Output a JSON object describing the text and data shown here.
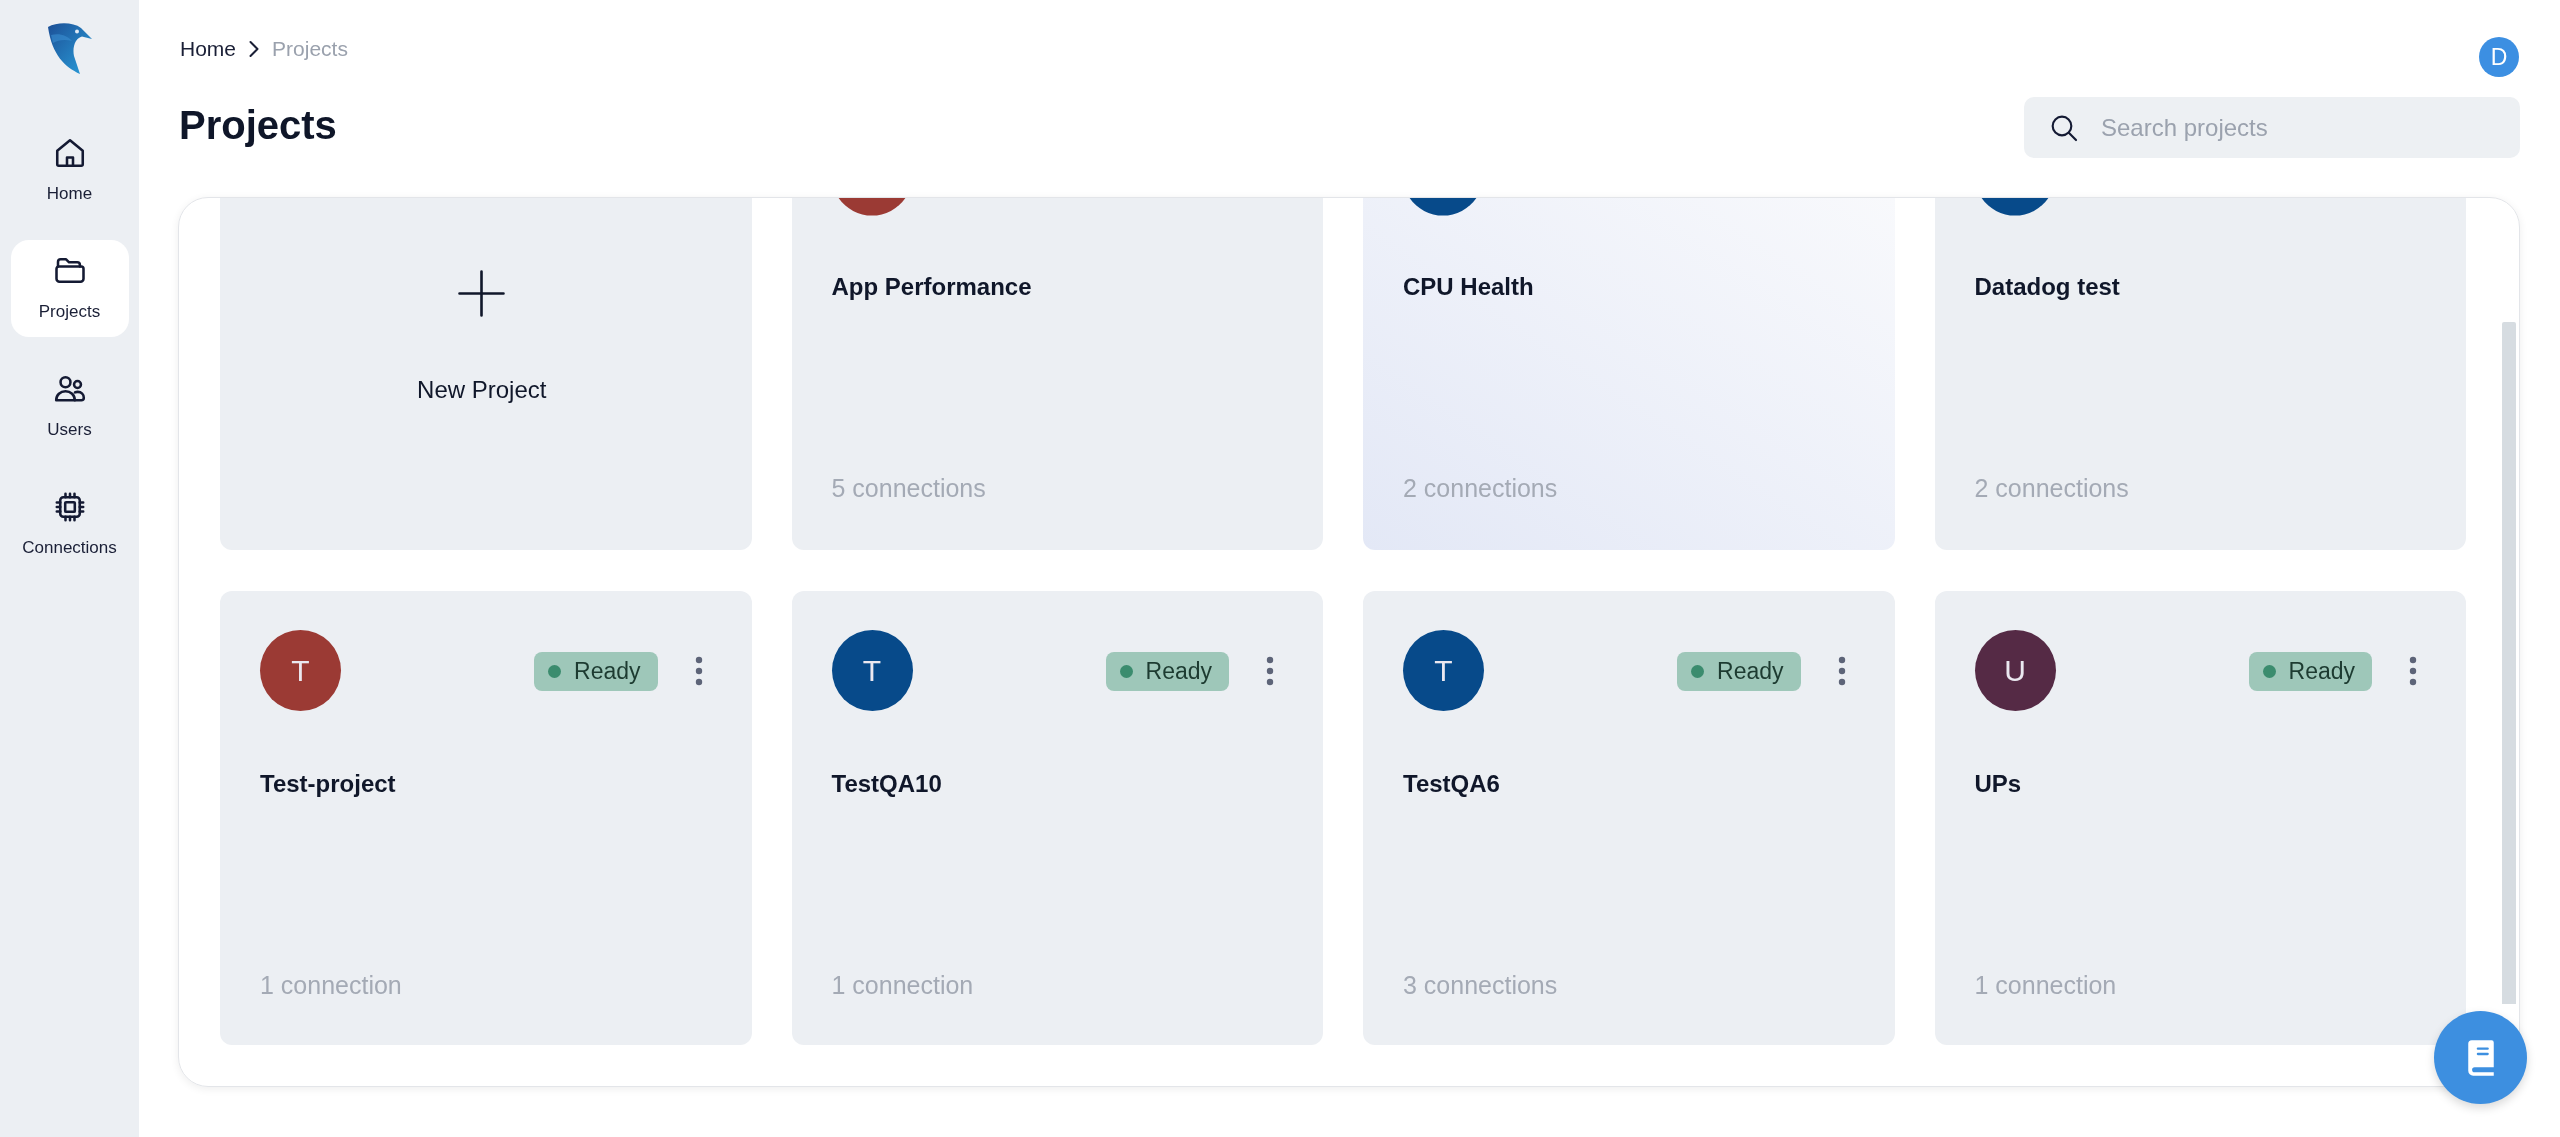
{
  "sidebar": {
    "items": [
      {
        "label": "Home",
        "selected": false
      },
      {
        "label": "Projects",
        "selected": true
      },
      {
        "label": "Users",
        "selected": false
      },
      {
        "label": "Connections",
        "selected": false
      }
    ]
  },
  "breadcrumb": [
    {
      "label": "Home",
      "current": false
    },
    {
      "label": "Projects",
      "current": true
    }
  ],
  "page_title": "Projects",
  "user_avatar": {
    "letter": "D"
  },
  "search": {
    "placeholder": "Search projects"
  },
  "new_project": {
    "label": "New Project"
  },
  "projects": [
    {
      "name": "App Performance",
      "color": "#9b3a34",
      "connections": "5 connections",
      "highlighted": false
    },
    {
      "name": "CPU Health",
      "color": "#074a8a",
      "connections": "2 connections",
      "highlighted": true
    },
    {
      "name": "Datadog test",
      "color": "#074a8a",
      "connections": "2 connections",
      "highlighted": false
    },
    {
      "name": "Test-project",
      "letter": "T",
      "color": "#9b3a34",
      "status": "Ready",
      "connections": "1 connection",
      "highlighted": false
    },
    {
      "name": "TestQA10",
      "letter": "T",
      "color": "#074a8a",
      "status": "Ready",
      "connections": "1 connection",
      "highlighted": false
    },
    {
      "name": "TestQA6",
      "letter": "T",
      "color": "#074a8a",
      "status": "Ready",
      "connections": "3 connections",
      "highlighted": false
    },
    {
      "name": "UPs",
      "letter": "U",
      "color": "#552a45",
      "status": "Ready",
      "connections": "1 connection",
      "highlighted": false
    }
  ]
}
